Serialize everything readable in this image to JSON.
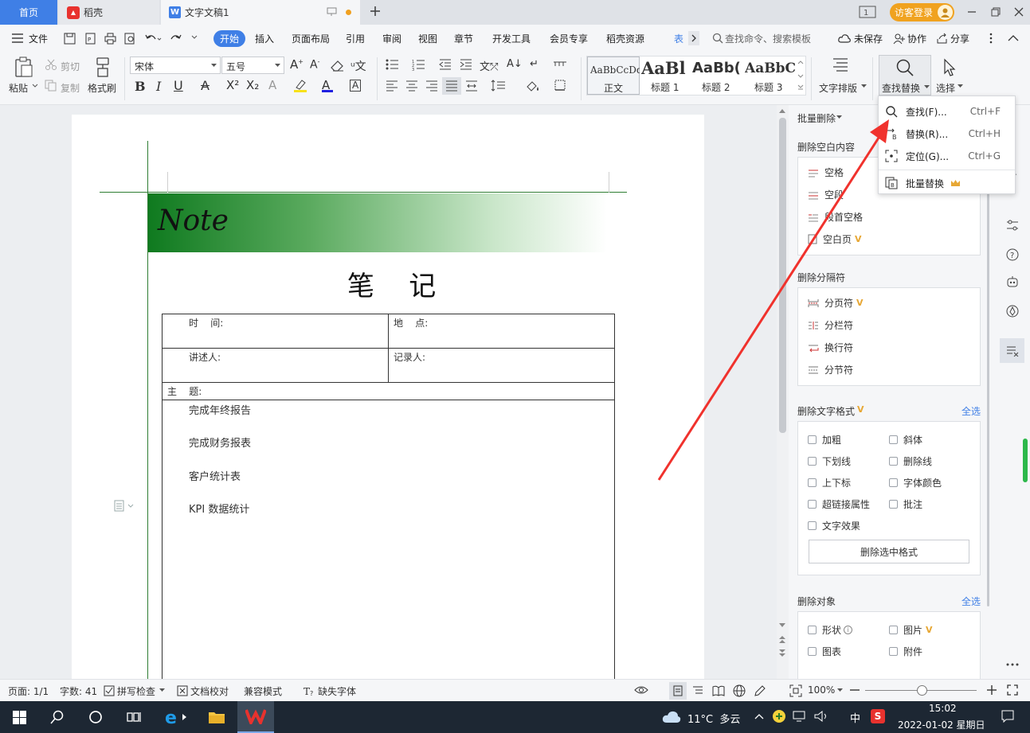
{
  "tabs": {
    "home": "首页",
    "daoke": "稻壳",
    "document": "文字文稿1",
    "user_button": "访客登录"
  },
  "menu": {
    "file": "文件",
    "items": [
      "开始",
      "插入",
      "页面布局",
      "引用",
      "审阅",
      "视图",
      "章节",
      "开发工具",
      "会员专享",
      "稻壳资源",
      "表"
    ],
    "search_placeholder": "查找命令、搜索模板",
    "unsaved": "未保存",
    "collaborate": "协作",
    "share": "分享"
  },
  "ribbon": {
    "paste": "粘贴",
    "cut": "剪切",
    "copy": "复制",
    "format_painter": "格式刷",
    "font_name": "宋体",
    "font_size": "五号",
    "styles": [
      {
        "sample": "AaBbCcDd",
        "label": "正文"
      },
      {
        "sample": "AaBl",
        "label": "标题 1"
      },
      {
        "sample": "AaBb(",
        "label": "标题 2"
      },
      {
        "sample": "AaBbC",
        "label": "标题 3"
      }
    ],
    "text_layout": "文字排版",
    "find_replace": "查找替换",
    "select": "选择"
  },
  "dropdown": {
    "find": "查找(F)...",
    "find_key": "Ctrl+F",
    "replace": "替换(R)...",
    "replace_key": "Ctrl+H",
    "goto": "定位(G)...",
    "goto_key": "Ctrl+G",
    "batch_replace": "批量替换"
  },
  "document": {
    "banner": "Note",
    "title": "笔    记",
    "time_label": "时    间:",
    "place_label": "地    点:",
    "speaker_label": "讲述人:",
    "recorder_label": "记录人:",
    "subject_label": "主    题:",
    "items": [
      "完成年终报告",
      "完成财务报表",
      "客户统计表",
      "KPI 数据统计"
    ]
  },
  "panel": {
    "batch_delete": "批量删除",
    "sec_blank": "删除空白内容",
    "blank_items": [
      "空格",
      "空段",
      "段首空格",
      "空白页"
    ],
    "sec_breaks": "删除分隔符",
    "break_items": [
      "分页符",
      "分栏符",
      "换行符",
      "分节符"
    ],
    "sec_format": "删除文字格式",
    "select_all": "全选",
    "format_items": [
      "加粗",
      "斜体",
      "下划线",
      "删除线",
      "上下标",
      "字体颜色",
      "超链接属性",
      "批注",
      "文字效果"
    ],
    "delete_format_button": "删除选中格式",
    "sec_objects": "删除对象",
    "object_items": [
      "形状",
      "图片",
      "图表",
      "附件"
    ]
  },
  "status": {
    "page": "页面: 1/1",
    "words": "字数: 41",
    "spell": "拼写检查",
    "proofread": "文档校对",
    "compat": "兼容模式",
    "missing_font": "缺失字体",
    "zoom": "100%"
  },
  "taskbar": {
    "weather": "11°C  多云",
    "ime": "中",
    "time": "15:02",
    "date": "2022-01-02 星期日"
  },
  "colors": {
    "accent": "#3f7fe6",
    "banner_green": "#1a8a2a",
    "arrow_red": "#f0322d",
    "vip_gold": "#e7a734"
  }
}
